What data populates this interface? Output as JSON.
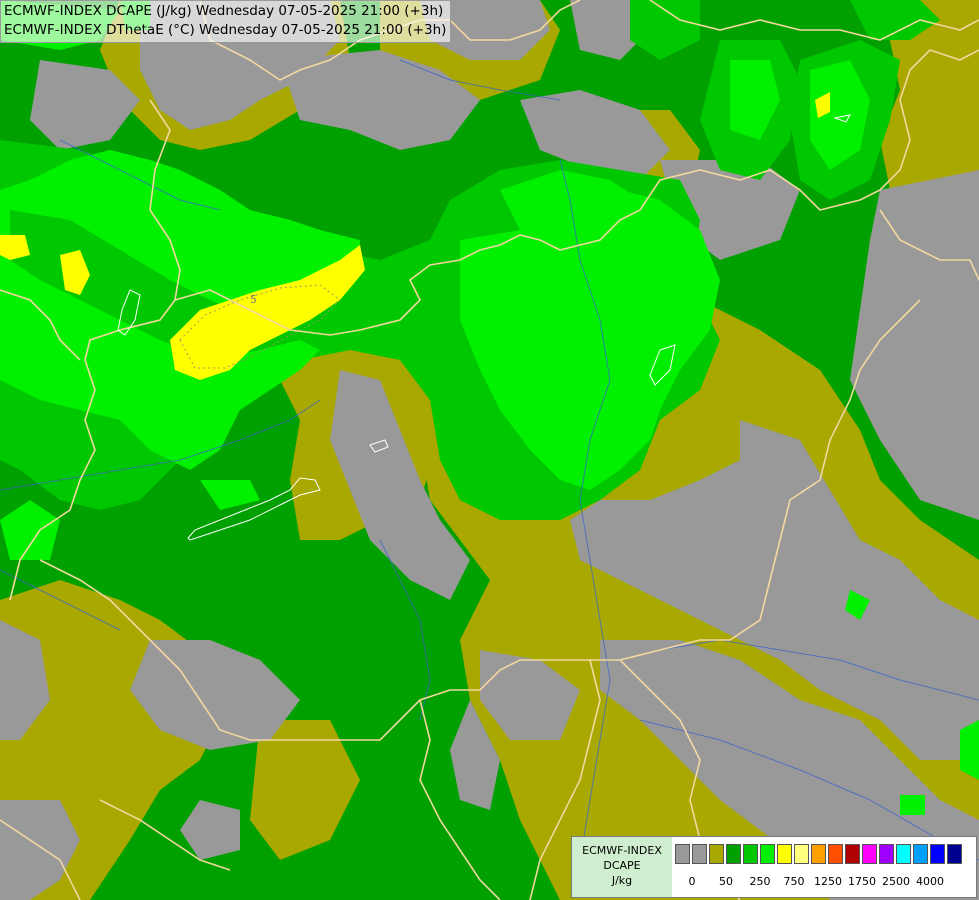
{
  "header": {
    "line1": "ECMWF-INDEX DCAPE (J/kg) Wednesday 07-05-2025 21:00 (+3h)",
    "line2": "ECMWF-INDEX DThetaE (°C) Wednesday 07-05-2025 21:00 (+3h)"
  },
  "map": {
    "contour_label": "5",
    "colors": {
      "no_data_gray": "#999999",
      "olive_0_50": "#a8a800",
      "green_50_250": "#00a000",
      "green_250": "#00c800",
      "lightgreen_250_750": "#00f000",
      "yellow_750": "#ffff00",
      "border": "#f2d8a0",
      "river": "#3c64c8"
    }
  },
  "legend": {
    "title_line1": "ECMWF-INDEX",
    "title_line2": "DCAPE",
    "unit": "J/kg",
    "swatch_colors": [
      "#999999",
      "#999999",
      "#a8a800",
      "#00a000",
      "#00c800",
      "#00f000",
      "#ffff00",
      "#ffff80",
      "#ffa000",
      "#ff5000",
      "#b00000",
      "#ff00ff",
      "#a000ff",
      "#00ffff",
      "#00a0ff",
      "#0000ff",
      "#000090"
    ],
    "tick_labels": [
      "0",
      "50",
      "250",
      "750",
      "1250",
      "1750",
      "2500",
      "4000"
    ]
  }
}
